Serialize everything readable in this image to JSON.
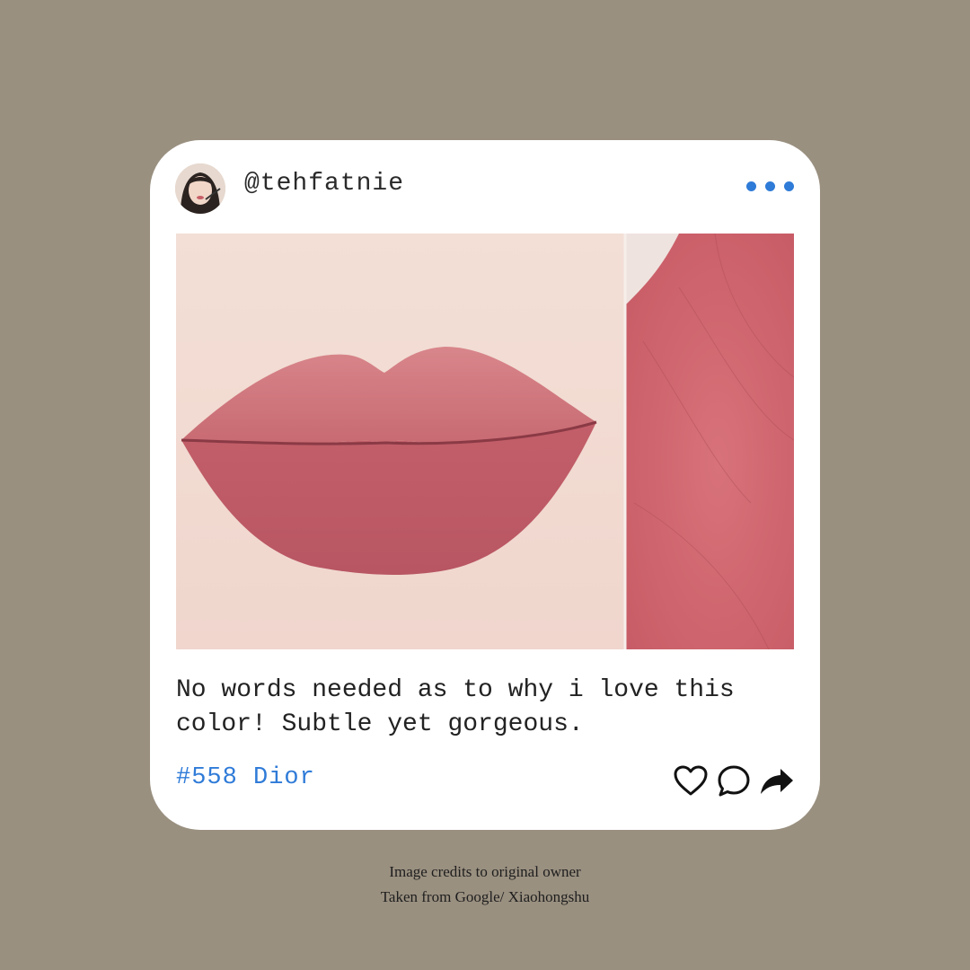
{
  "post": {
    "username": "@tehfatnie",
    "caption_lines": [
      "No words needed as to why i love this",
      "color! Subtle yet gorgeous."
    ],
    "tag": "#558 Dior",
    "avatar_icon": "avatar-photo",
    "more_icon": "more-dots-icon",
    "actions": [
      "heart-icon",
      "comment-icon",
      "share-icon"
    ],
    "accent_color": "#2f7bd8",
    "background_color": "#9a9080"
  },
  "footer": {
    "line1": "Image credits to original owner",
    "line2": "Taken from Google/ Xiaohongshu"
  }
}
